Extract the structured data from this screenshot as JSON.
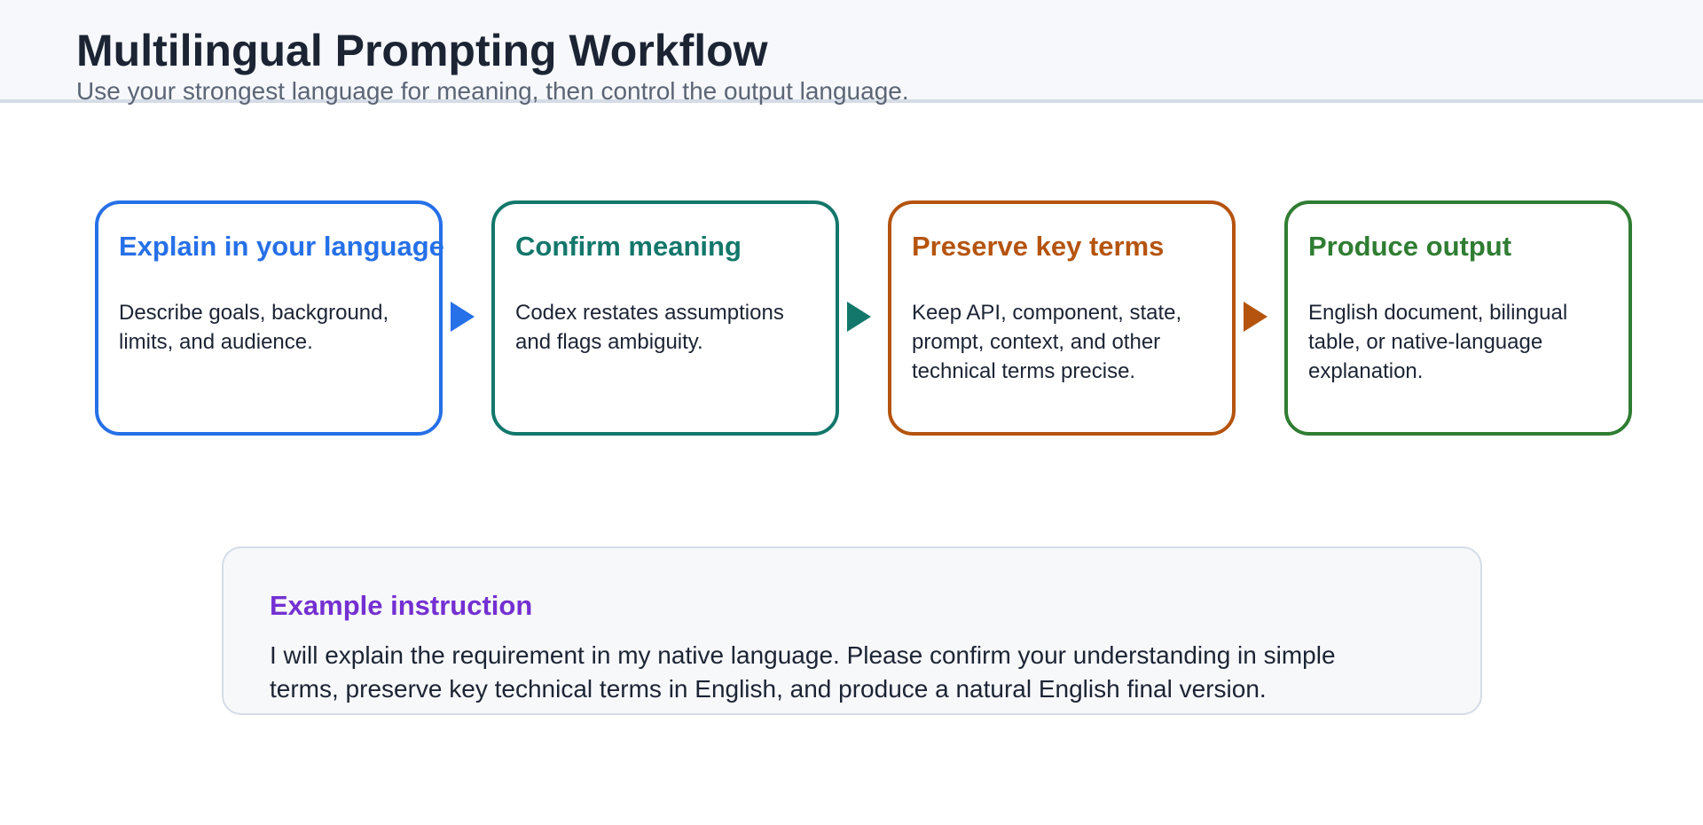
{
  "header": {
    "title": "Multilingual Prompting Workflow",
    "subtitle": "Use your strongest language for meaning, then control the output language."
  },
  "steps": [
    {
      "title": "Explain in your language",
      "description": "Describe goals, background, limits, and audience.",
      "color": "#2670e8"
    },
    {
      "title": "Confirm meaning",
      "description": "Codex restates assumptions and flags ambiguity.",
      "color": "#13776b"
    },
    {
      "title": "Preserve key terms",
      "description": "Keep API, component, state, prompt, context, and other technical terms precise.",
      "color": "#b5540f"
    },
    {
      "title": "Produce output",
      "description": "English document, bilingual table, or native-language explanation.",
      "color": "#2f7d32"
    }
  ],
  "arrow_icon": "triangle-right-icon",
  "example": {
    "title": "Example instruction",
    "text": "I will explain the requirement in my native language. Please confirm your understanding in simple terms, preserve key technical terms in English, and produce a natural English final version.",
    "title_color": "#7430d1"
  }
}
